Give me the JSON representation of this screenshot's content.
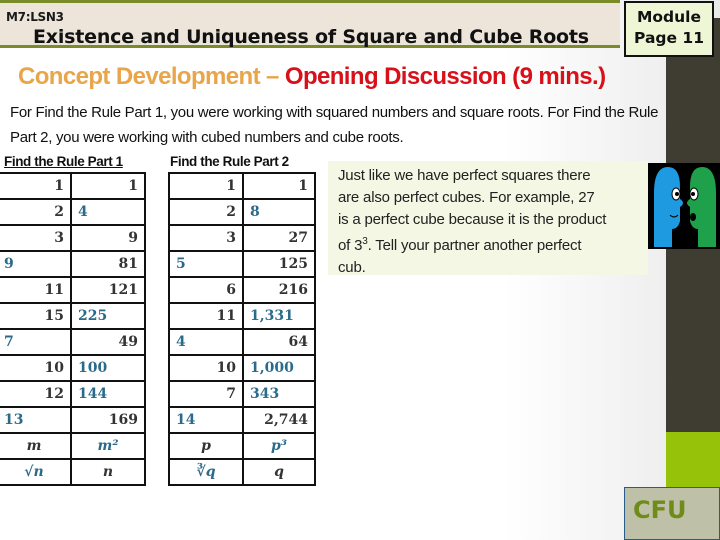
{
  "header": {
    "lesson_code": "M7:LSN3",
    "title": "Existence and Uniqueness of Square and Cube Roots",
    "module_label": "Module",
    "page_label": "Page 11"
  },
  "section": {
    "title_part1": "Concept Development –",
    "title_part2": "Opening Discussion (9 mins.)",
    "intro": "For Find the Rule Part 1, you were working with squared numbers and square roots.  For Find the Rule Part 2, you were working with cubed numbers and cube roots."
  },
  "table1": {
    "heading": "Find the Rule Part 1",
    "rows": [
      {
        "a": "1",
        "b": "1",
        "a_style": "r",
        "b_style": "r",
        "a_blue": false,
        "b_blue": false
      },
      {
        "a": "2",
        "b": "4",
        "a_style": "r",
        "b_style": "l",
        "a_blue": false,
        "b_blue": true
      },
      {
        "a": "3",
        "b": "9",
        "a_style": "r",
        "b_style": "r",
        "a_blue": false,
        "b_blue": false
      },
      {
        "a": "9",
        "b": "81",
        "a_style": "l",
        "b_style": "r",
        "a_blue": true,
        "b_blue": false
      },
      {
        "a": "11",
        "b": "121",
        "a_style": "r",
        "b_style": "r",
        "a_blue": false,
        "b_blue": false
      },
      {
        "a": "15",
        "b": "225",
        "a_style": "r",
        "b_style": "l",
        "a_blue": false,
        "b_blue": true
      },
      {
        "a": "7",
        "b": "49",
        "a_style": "l",
        "b_style": "r",
        "a_blue": true,
        "b_blue": false
      },
      {
        "a": "10",
        "b": "100",
        "a_style": "r",
        "b_style": "l",
        "a_blue": false,
        "b_blue": true
      },
      {
        "a": "12",
        "b": "144",
        "a_style": "r",
        "b_style": "l",
        "a_blue": false,
        "b_blue": true
      },
      {
        "a": "13",
        "b": "169",
        "a_style": "l",
        "b_style": "r",
        "a_blue": true,
        "b_blue": false
      },
      {
        "a": "m",
        "b": "m²",
        "a_style": "c",
        "b_style": "c",
        "a_blue": false,
        "b_blue": true,
        "math": true
      },
      {
        "a": "√n",
        "b": "n",
        "a_style": "c",
        "b_style": "c",
        "a_blue": true,
        "b_blue": false,
        "math": true
      }
    ]
  },
  "table2": {
    "heading": "Find the Rule Part 2",
    "rows": [
      {
        "a": "1",
        "b": "1",
        "a_style": "r",
        "b_style": "r",
        "a_blue": false,
        "b_blue": false
      },
      {
        "a": "2",
        "b": "8",
        "a_style": "r",
        "b_style": "l",
        "a_blue": false,
        "b_blue": true
      },
      {
        "a": "3",
        "b": "27",
        "a_style": "r",
        "b_style": "r",
        "a_blue": false,
        "b_blue": false
      },
      {
        "a": "5",
        "b": "125",
        "a_style": "l",
        "b_style": "r",
        "a_blue": true,
        "b_blue": false
      },
      {
        "a": "6",
        "b": "216",
        "a_style": "r",
        "b_style": "r",
        "a_blue": false,
        "b_blue": false
      },
      {
        "a": "11",
        "b": "1,331",
        "a_style": "r",
        "b_style": "l",
        "a_blue": false,
        "b_blue": true
      },
      {
        "a": "4",
        "b": "64",
        "a_style": "l",
        "b_style": "r",
        "a_blue": true,
        "b_blue": false
      },
      {
        "a": "10",
        "b": "1,000",
        "a_style": "r",
        "b_style": "l",
        "a_blue": false,
        "b_blue": true
      },
      {
        "a": "7",
        "b": "343",
        "a_style": "r",
        "b_style": "l",
        "a_blue": false,
        "b_blue": true
      },
      {
        "a": "14",
        "b": "2,744",
        "a_style": "l",
        "b_style": "r",
        "a_blue": true,
        "b_blue": false
      },
      {
        "a": "p",
        "b": "p³",
        "a_style": "c",
        "b_style": "c",
        "a_blue": false,
        "b_blue": true,
        "math": true
      },
      {
        "a": "∛q",
        "b": "q",
        "a_style": "c",
        "b_style": "c",
        "a_blue": true,
        "b_blue": false,
        "math": true
      }
    ]
  },
  "callout": {
    "line1": "Just like we have perfect squares there",
    "line2": "are also perfect cubes.  For example, 27",
    "line3": "is a perfect cube because it is the product",
    "line4_pre": "of 3",
    "line4_sup": "3",
    "line4_post": ". Tell your partner another perfect",
    "line5": "cub."
  },
  "illustration": {
    "icon": "two-faces-talking-icon",
    "left_face_color": "#1e9be0",
    "right_face_color": "#1fa04a"
  },
  "cfu": {
    "label": "CFU"
  },
  "colors": {
    "accent_green": "#97c20a",
    "header_rule": "#7a8c2a",
    "title_orange": "#e8a54a",
    "title_red": "#d8101a",
    "answer_blue": "#2a6a8a",
    "dark_band": "#3f3c32"
  }
}
